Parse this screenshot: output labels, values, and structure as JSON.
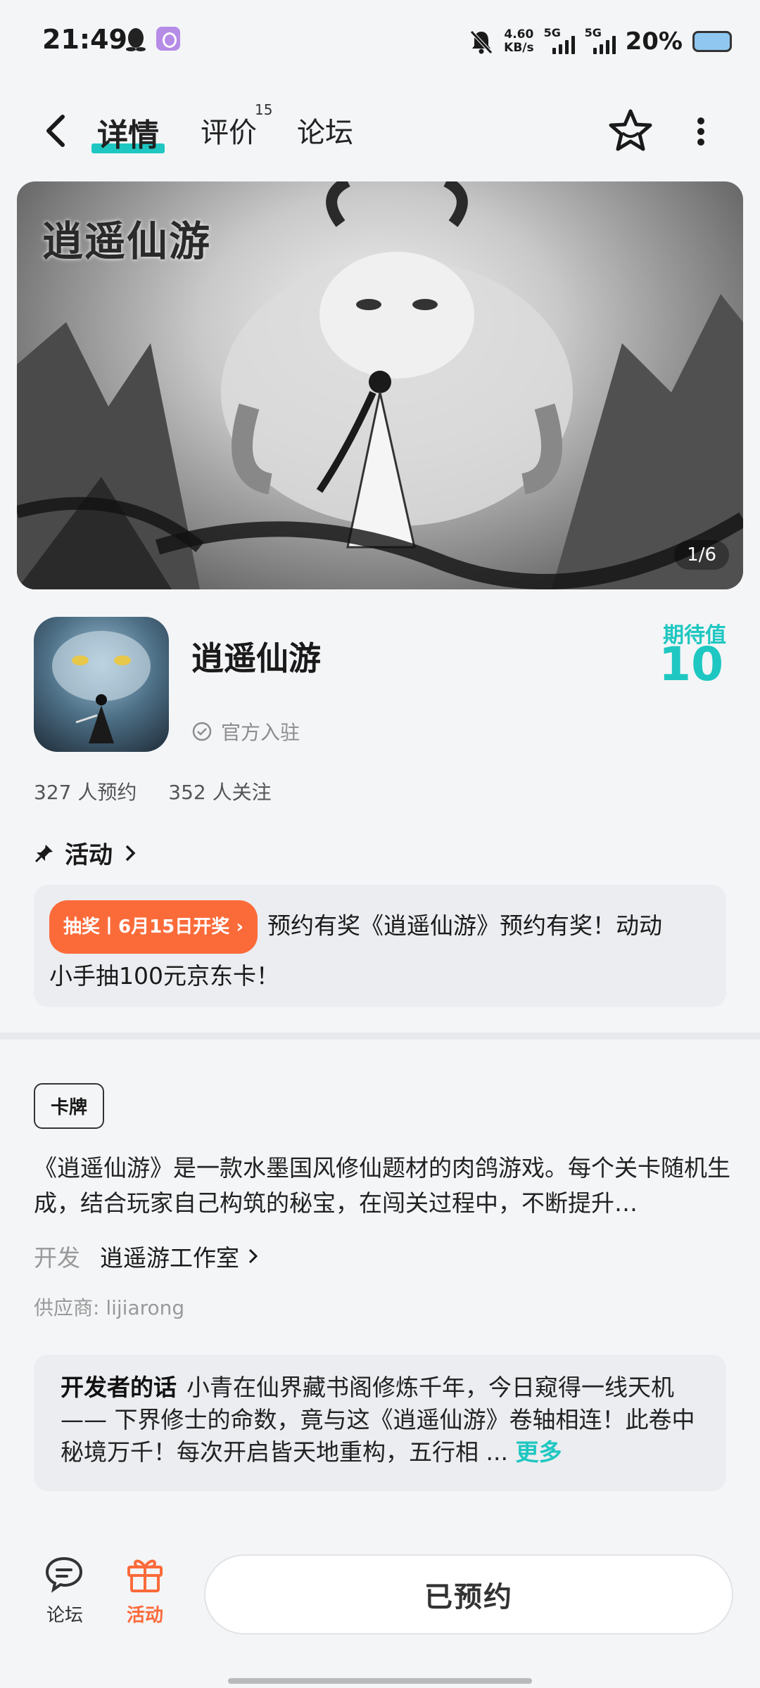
{
  "status_bar": {
    "time": "21:49",
    "net_speed_value": "4.60",
    "net_speed_unit": "KB/s",
    "sim1": "5G",
    "sim2": "5G",
    "battery": "20%"
  },
  "nav": {
    "tabs": [
      {
        "label": "详情",
        "active": true
      },
      {
        "label": "评价",
        "badge": "15"
      },
      {
        "label": "论坛"
      }
    ],
    "icons": [
      "back-icon",
      "star-icon",
      "more-icon"
    ]
  },
  "banner": {
    "logo_text": "逍遥仙游",
    "pager": "1/6"
  },
  "game": {
    "title": "逍遥仙游",
    "official_label": "官方入驻",
    "expect_label": "期待值",
    "expect_value": "10",
    "reservations": "327 人预约",
    "followers": "352 人关注"
  },
  "activity": {
    "heading": "活动",
    "tag": "抽奖丨6月15日开奖 ›",
    "text_line1": "预约有奖《逍遥仙游》预约有奖！动动",
    "text_line2": "小手抽100元京东卡！"
  },
  "description": {
    "tag": "卡牌",
    "text": "《逍遥仙游》是一款水墨国风修仙题材的肉鸽游戏。每个关卡随机生成，结合玩家自己构筑的秘宝，在闯关过程中，不断提升…",
    "developer_label": "开发",
    "developer_name": "逍遥游工作室",
    "supplier": "供应商: lijiarong"
  },
  "dev_words": {
    "label": "开发者的话",
    "text": "小青在仙界藏书阁修炼千年，今日窥得一线天机 —— 下界修士的命数，竟与这《逍遥仙游》卷轴相连！此卷中秘境万千！每次开启皆天地重构，五行相 ...",
    "more": "更多"
  },
  "bottom_bar": {
    "forum_label": "论坛",
    "activity_label": "活动",
    "action_label": "已预约"
  },
  "colors": {
    "accent_teal": "#1ec7c1",
    "accent_orange": "#fb6b3a",
    "background": "#f4f5f7"
  }
}
